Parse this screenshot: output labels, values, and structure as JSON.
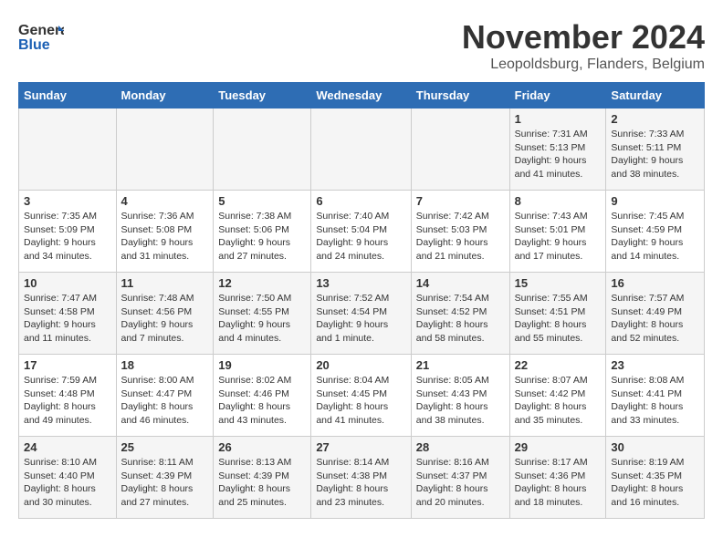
{
  "header": {
    "logo_general": "General",
    "logo_blue": "Blue",
    "month_title": "November 2024",
    "location": "Leopoldsburg, Flanders, Belgium"
  },
  "calendar": {
    "columns": [
      "Sunday",
      "Monday",
      "Tuesday",
      "Wednesday",
      "Thursday",
      "Friday",
      "Saturday"
    ],
    "weeks": [
      {
        "days": [
          {
            "number": "",
            "info": ""
          },
          {
            "number": "",
            "info": ""
          },
          {
            "number": "",
            "info": ""
          },
          {
            "number": "",
            "info": ""
          },
          {
            "number": "",
            "info": ""
          },
          {
            "number": "1",
            "info": "Sunrise: 7:31 AM\nSunset: 5:13 PM\nDaylight: 9 hours\nand 41 minutes."
          },
          {
            "number": "2",
            "info": "Sunrise: 7:33 AM\nSunset: 5:11 PM\nDaylight: 9 hours\nand 38 minutes."
          }
        ]
      },
      {
        "days": [
          {
            "number": "3",
            "info": "Sunrise: 7:35 AM\nSunset: 5:09 PM\nDaylight: 9 hours\nand 34 minutes."
          },
          {
            "number": "4",
            "info": "Sunrise: 7:36 AM\nSunset: 5:08 PM\nDaylight: 9 hours\nand 31 minutes."
          },
          {
            "number": "5",
            "info": "Sunrise: 7:38 AM\nSunset: 5:06 PM\nDaylight: 9 hours\nand 27 minutes."
          },
          {
            "number": "6",
            "info": "Sunrise: 7:40 AM\nSunset: 5:04 PM\nDaylight: 9 hours\nand 24 minutes."
          },
          {
            "number": "7",
            "info": "Sunrise: 7:42 AM\nSunset: 5:03 PM\nDaylight: 9 hours\nand 21 minutes."
          },
          {
            "number": "8",
            "info": "Sunrise: 7:43 AM\nSunset: 5:01 PM\nDaylight: 9 hours\nand 17 minutes."
          },
          {
            "number": "9",
            "info": "Sunrise: 7:45 AM\nSunset: 4:59 PM\nDaylight: 9 hours\nand 14 minutes."
          }
        ]
      },
      {
        "days": [
          {
            "number": "10",
            "info": "Sunrise: 7:47 AM\nSunset: 4:58 PM\nDaylight: 9 hours\nand 11 minutes."
          },
          {
            "number": "11",
            "info": "Sunrise: 7:48 AM\nSunset: 4:56 PM\nDaylight: 9 hours\nand 7 minutes."
          },
          {
            "number": "12",
            "info": "Sunrise: 7:50 AM\nSunset: 4:55 PM\nDaylight: 9 hours\nand 4 minutes."
          },
          {
            "number": "13",
            "info": "Sunrise: 7:52 AM\nSunset: 4:54 PM\nDaylight: 9 hours\nand 1 minute."
          },
          {
            "number": "14",
            "info": "Sunrise: 7:54 AM\nSunset: 4:52 PM\nDaylight: 8 hours\nand 58 minutes."
          },
          {
            "number": "15",
            "info": "Sunrise: 7:55 AM\nSunset: 4:51 PM\nDaylight: 8 hours\nand 55 minutes."
          },
          {
            "number": "16",
            "info": "Sunrise: 7:57 AM\nSunset: 4:49 PM\nDaylight: 8 hours\nand 52 minutes."
          }
        ]
      },
      {
        "days": [
          {
            "number": "17",
            "info": "Sunrise: 7:59 AM\nSunset: 4:48 PM\nDaylight: 8 hours\nand 49 minutes."
          },
          {
            "number": "18",
            "info": "Sunrise: 8:00 AM\nSunset: 4:47 PM\nDaylight: 8 hours\nand 46 minutes."
          },
          {
            "number": "19",
            "info": "Sunrise: 8:02 AM\nSunset: 4:46 PM\nDaylight: 8 hours\nand 43 minutes."
          },
          {
            "number": "20",
            "info": "Sunrise: 8:04 AM\nSunset: 4:45 PM\nDaylight: 8 hours\nand 41 minutes."
          },
          {
            "number": "21",
            "info": "Sunrise: 8:05 AM\nSunset: 4:43 PM\nDaylight: 8 hours\nand 38 minutes."
          },
          {
            "number": "22",
            "info": "Sunrise: 8:07 AM\nSunset: 4:42 PM\nDaylight: 8 hours\nand 35 minutes."
          },
          {
            "number": "23",
            "info": "Sunrise: 8:08 AM\nSunset: 4:41 PM\nDaylight: 8 hours\nand 33 minutes."
          }
        ]
      },
      {
        "days": [
          {
            "number": "24",
            "info": "Sunrise: 8:10 AM\nSunset: 4:40 PM\nDaylight: 8 hours\nand 30 minutes."
          },
          {
            "number": "25",
            "info": "Sunrise: 8:11 AM\nSunset: 4:39 PM\nDaylight: 8 hours\nand 27 minutes."
          },
          {
            "number": "26",
            "info": "Sunrise: 8:13 AM\nSunset: 4:39 PM\nDaylight: 8 hours\nand 25 minutes."
          },
          {
            "number": "27",
            "info": "Sunrise: 8:14 AM\nSunset: 4:38 PM\nDaylight: 8 hours\nand 23 minutes."
          },
          {
            "number": "28",
            "info": "Sunrise: 8:16 AM\nSunset: 4:37 PM\nDaylight: 8 hours\nand 20 minutes."
          },
          {
            "number": "29",
            "info": "Sunrise: 8:17 AM\nSunset: 4:36 PM\nDaylight: 8 hours\nand 18 minutes."
          },
          {
            "number": "30",
            "info": "Sunrise: 8:19 AM\nSunset: 4:35 PM\nDaylight: 8 hours\nand 16 minutes."
          }
        ]
      }
    ]
  }
}
